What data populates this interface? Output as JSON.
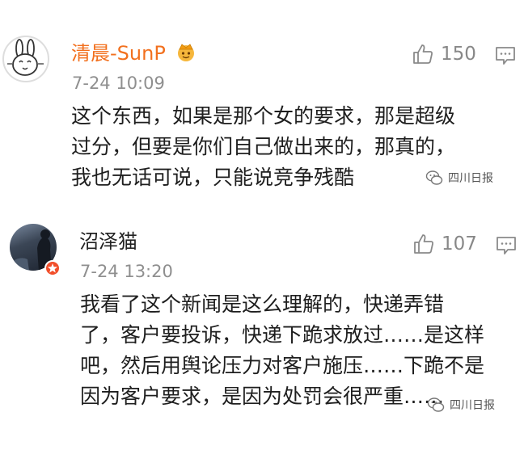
{
  "comments": [
    {
      "username": "清晨-SunP",
      "timestamp": "7-24 10:09",
      "likes": "150",
      "text_lines": [
        "这个东西，如果是那个女的要求，那是超级",
        "过分，但要是你们自己做出来的，那真的，",
        "我也无话可说，只能说竞争残酷"
      ],
      "watermark": "四川日报"
    },
    {
      "username": "沼泽猫",
      "timestamp": "7-24 13:20",
      "likes": "107",
      "text_lines": [
        "我看了这个新闻是这么理解的，快递弄错",
        "了，客户要投诉，快递下跪求放过……是这样",
        "吧，然后用舆论压力对客户施压……下跪不是",
        "因为客户要求，是因为处罚会很严重……"
      ],
      "watermark": "四川日报"
    }
  ],
  "colors": {
    "username_highlight": "#f2701e",
    "meta_gray": "#8f8f8f",
    "badge_red": "#f14e2a"
  },
  "icons": [
    "rabbit-avatar",
    "crown-emoji-icon",
    "thumbs-up-icon",
    "comment-icon",
    "verified-badge-icon",
    "wechat-logo-icon"
  ]
}
